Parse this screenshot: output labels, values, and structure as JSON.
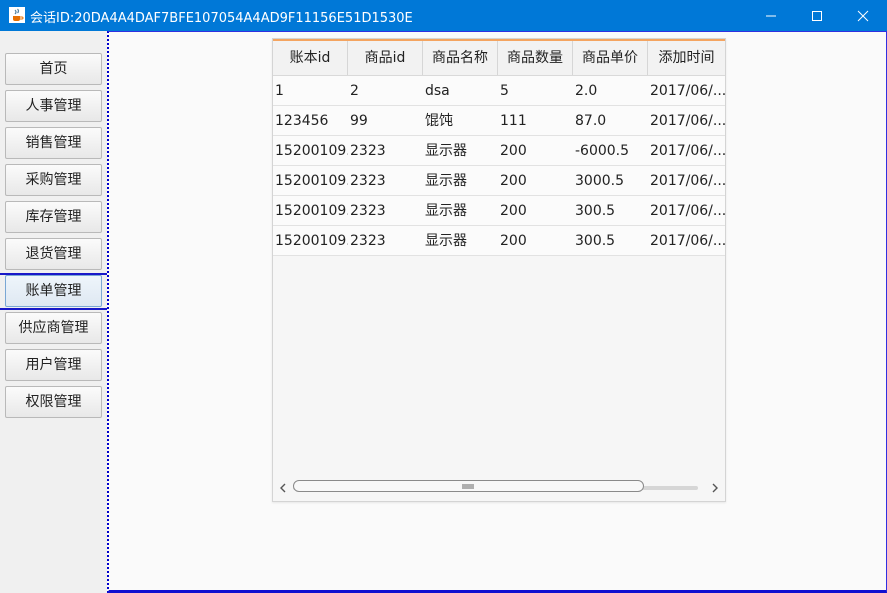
{
  "window": {
    "title": "会话ID:20DA4A4DAF7BFE107054A4AD9F11156E51D1530E",
    "icons": {
      "app": "java-cup-icon",
      "minimize": "minimize-icon",
      "maximize": "maximize-icon",
      "close": "close-icon"
    }
  },
  "sidebar": {
    "items": [
      {
        "label": "首页"
      },
      {
        "label": "人事管理"
      },
      {
        "label": "销售管理"
      },
      {
        "label": "采购管理"
      },
      {
        "label": "库存管理"
      },
      {
        "label": "退货管理"
      },
      {
        "label": "账单管理",
        "active": true
      },
      {
        "label": "供应商管理"
      },
      {
        "label": "用户管理"
      },
      {
        "label": "权限管理"
      }
    ]
  },
  "table": {
    "columns": [
      "账本id",
      "商品id",
      "商品名称",
      "商品数量",
      "商品单价",
      "添加时间"
    ],
    "rows": [
      [
        "1",
        "2",
        "dsa",
        "5",
        "2.0",
        "2017/06/..."
      ],
      [
        "123456",
        "99",
        "馄饨",
        "111",
        "87.0",
        "2017/06/..."
      ],
      [
        "15200109...",
        "2323",
        "显示器",
        "200",
        "-6000.5",
        "2017/06/..."
      ],
      [
        "15200109...",
        "2323",
        "显示器",
        "200",
        "3000.5",
        "2017/06/..."
      ],
      [
        "15200109...",
        "2323",
        "显示器",
        "200",
        "300.5",
        "2017/06/..."
      ],
      [
        "15200109...",
        "2323",
        "显示器",
        "200",
        "300.5",
        "2017/06/..."
      ]
    ]
  },
  "colors": {
    "titlebar": "#0078d7",
    "focus_border": "#1010d0",
    "header_accent": "#f4a460"
  }
}
